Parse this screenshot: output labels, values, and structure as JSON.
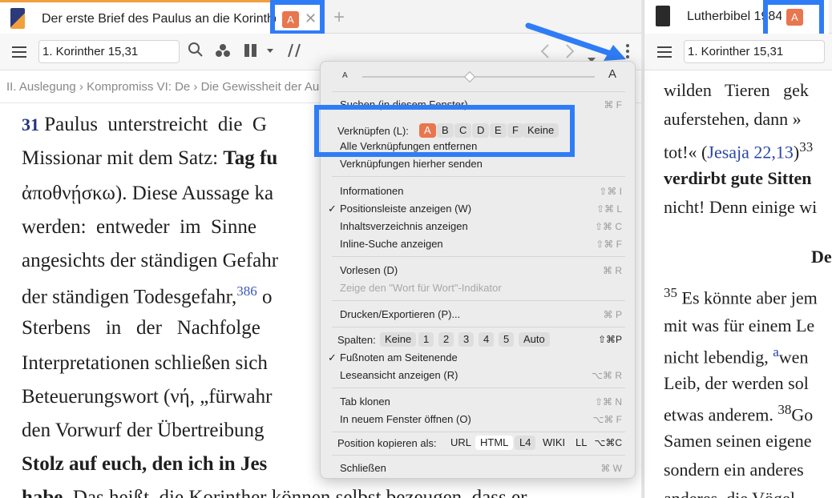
{
  "left": {
    "tab_title": "Der erste Brief des Paulus an die Korinther",
    "link_badge": "A",
    "close_glyph": "✕",
    "new_tab_glyph": "+",
    "reference": "1. Korinther 15,31",
    "breadcrumb": "II. Auslegung › Kompromiss VI: De › Die Gewissheit der Au",
    "book_color": "#f0a03c",
    "lines": [
      {
        "verse": "31",
        "text": " Paulus  unterstreicht  die  G"
      },
      {
        "text": "Missionar mit dem Satz: ",
        "bold": "Tag fu"
      },
      {
        "text": "ἀποθνῄσκω). Diese Aussage ka"
      },
      {
        "text": "werden:  entweder  im  Sinne"
      },
      {
        "text": "angesichts der ständigen Gefahr"
      },
      {
        "text": "der ständigen Todesgefahr,",
        "sup": "386",
        "after": " o"
      },
      {
        "text": "Sterbens   in   der   Nachfolge"
      },
      {
        "text": "Interpretationen schließen sich"
      },
      {
        "text": "Beteuerungswort (νή, „fürwahr"
      },
      {
        "text": "den Vorwurf der Übertreibung"
      },
      {
        "bold": "Stolz auf euch, den ich in Jes"
      },
      {
        "bold": "habe",
        "text": ". Das heißt, die Korinther können selbst bezeugen, dass er"
      }
    ]
  },
  "right": {
    "tab_title": "Lutherbibel 1984",
    "link_badge": "A",
    "reference": "1. Korinther 15,31",
    "lines": [
      {
        "text": "wilden   Tieren   gek"
      },
      {
        "text": "auferstehen, dann »"
      },
      {
        "text": "tot!« (",
        "link": "Jesaja 22,13",
        "after": ")",
        "sup": "33"
      },
      {
        "bold": "verdirbt gute Sitten"
      },
      {
        "text": "nicht! Denn einige wi"
      },
      {
        "heading": "De"
      },
      {
        "sup_first": "35",
        "text": " Es könnte aber jem"
      },
      {
        "text": "mit was für einem Le"
      },
      {
        "text": "nicht lebendig, ",
        "sup_link": "a",
        "after": "wen"
      },
      {
        "text": "Leib, der werden sol"
      },
      {
        "text": "etwas anderem. ",
        "sup": "38",
        "after": "Go"
      },
      {
        "text": "Samen seinen eigene"
      },
      {
        "text": "sondern ein anderes"
      },
      {
        "text": "anderes, die Vögel"
      }
    ]
  },
  "menu": {
    "font_small": "A",
    "font_large": "A",
    "search": {
      "label": "Suchen (in diesem Fenster)",
      "shortcut": "⌘ F"
    },
    "link_row": {
      "label": "Verknüpfen (L):",
      "options": [
        "A",
        "B",
        "C",
        "D",
        "E",
        "F",
        "Keine"
      ]
    },
    "remove_links": "Alle Verknüpfungen entfernen",
    "send_links": "Verknüpfungen hierher senden",
    "info": {
      "label": "Informationen",
      "shortcut": "⇧⌘ I"
    },
    "position_bar": {
      "label": "Positionsleiste anzeigen (W)",
      "shortcut": "⇧⌘ L",
      "checked": "✓"
    },
    "toc": {
      "label": "Inhaltsverzeichnis anzeigen",
      "shortcut": "⇧⌘ C"
    },
    "inline_search": {
      "label": "Inline-Suche anzeigen",
      "shortcut": "⇧⌘ F"
    },
    "read_aloud": {
      "label": "Vorlesen (D)",
      "shortcut": "⌘ R"
    },
    "wfw": {
      "label": "Zeige den \"Wort für Wort\"-Indikator"
    },
    "print": {
      "label": "Drucken/Exportieren (P)...",
      "shortcut": "⌘ P"
    },
    "columns": {
      "label": "Spalten:",
      "options": [
        "Keine",
        "1",
        "2",
        "3",
        "4",
        "5",
        "Auto"
      ],
      "shortcut": "⇧⌘P"
    },
    "footnotes": {
      "label": "Fußnoten am Seitenende",
      "checked": "✓"
    },
    "reader": {
      "label": "Leseansicht anzeigen (R)",
      "shortcut": "⌥⌘ R"
    },
    "clone": {
      "label": "Tab klonen",
      "shortcut": "⇧⌘ N"
    },
    "new_window": {
      "label": "In neuem Fenster öffnen (O)",
      "shortcut": "⌥⌘ F"
    },
    "copy_pos": {
      "label": "Position kopieren als:",
      "options": [
        "URL",
        "HTML",
        "L4",
        "WIKI",
        "LL"
      ],
      "shortcut": "⌥⌘C"
    },
    "close": {
      "label": "Schließen",
      "shortcut": "⌘ W"
    }
  },
  "colors": {
    "highlight": "#2f7df6",
    "badge": "#e8764e"
  }
}
